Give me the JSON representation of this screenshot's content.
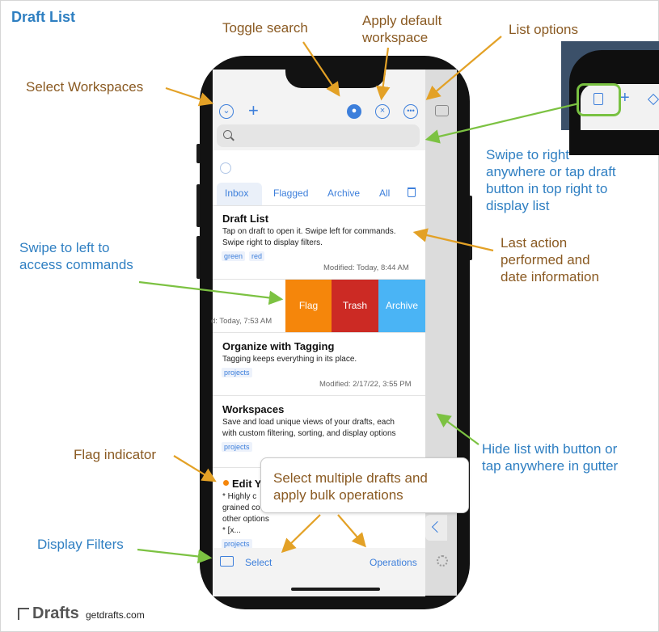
{
  "page": {
    "title": "Draft List"
  },
  "annotations": {
    "toggle_search": "Toggle search",
    "apply_default_workspace": "Apply default\nworkspace",
    "list_options": "List options",
    "select_workspaces": "Select Workspaces",
    "swipe_right": "Swipe to right\nanywhere or tap draft\nbutton in top right to\ndisplay list",
    "swipe_left": "Swipe to left to\naccess commands",
    "last_action": "Last action\nperformed and\ndate information",
    "hide_list": "Hide list with button or\ntap anywhere in gutter",
    "flag_indicator": "Flag indicator",
    "select_multiple": "Select multiple drafts and\napply bulk operations",
    "display_filters": "Display Filters"
  },
  "tabs": [
    "Inbox",
    "Flagged",
    "Archive",
    "All"
  ],
  "drafts": [
    {
      "title": "Draft List",
      "text": "Tap on draft to open it. Swipe left for commands.\nSwipe right to display filters.",
      "tags": [
        "green",
        "red"
      ],
      "modified": "Modified: Today, 8:44 AM"
    },
    {
      "title": "",
      "text": "",
      "tags": [],
      "modified": "d: Today, 7:53 AM"
    },
    {
      "title": "Organize with Tagging",
      "text": "Tagging keeps everything in its place.",
      "tags": [
        "projects"
      ],
      "modified": "Modified: 2/17/22, 3:55 PM"
    },
    {
      "title": "Workspaces",
      "text": "Save and load unique views of your drafts, each\nwith custom filtering, sorting, and display options",
      "tags": [
        "projects"
      ],
      "modified": ""
    },
    {
      "title": "Edit Y",
      "text": "* Highly c\ngrained co\nother options\n* [x...",
      "tags": [
        "projects"
      ],
      "modified": ""
    }
  ],
  "swipe_actions": [
    {
      "label": "Flag",
      "color": "#f5860b"
    },
    {
      "label": "Trash",
      "color": "#cc2a24"
    },
    {
      "label": "Archive",
      "color": "#4ab4f5"
    }
  ],
  "bottom_bar": {
    "select": "Select",
    "operations": "Operations"
  },
  "footer": {
    "logo": "Drafts",
    "url": "getdrafts.com"
  },
  "colors": {
    "accent": "#3d7fdb",
    "annotation_brown": "#8a5a22",
    "annotation_blue": "#2f7fc2",
    "arrow_orange": "#e3a126",
    "arrow_green": "#7cc242",
    "flag": "#f5860b"
  }
}
